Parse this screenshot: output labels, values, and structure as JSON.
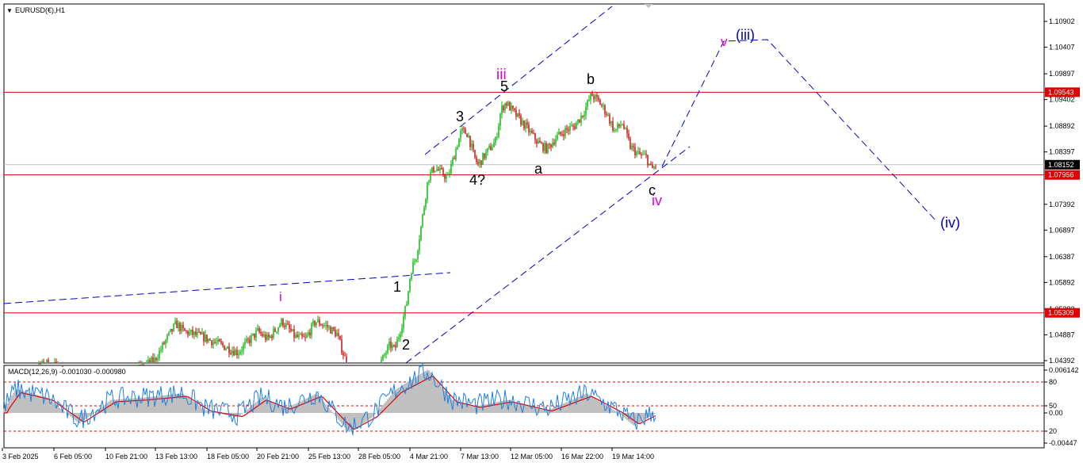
{
  "header": {
    "symbol_label": "EURUSD(€),H1"
  },
  "colors": {
    "bull": "#00b000",
    "bear": "#c00000",
    "level": "#e00000",
    "channel": "#0000c0",
    "magenta": "#e000e0",
    "macd_hist": "#c0c0c0",
    "macd_main": "#1e7fe0",
    "macd_signal": "#e00000"
  },
  "price_axis": {
    "ticks": [
      "1.10902",
      "1.10407",
      "1.09897",
      "1.09402",
      "1.08892",
      "1.08397",
      "1.07392",
      "1.06897",
      "1.06387",
      "1.05892",
      "1.05382",
      "1.04887",
      "1.04392"
    ],
    "range": [
      1.0435,
      1.1135
    ]
  },
  "horizontal_levels": [
    {
      "price": 1.09543,
      "label": "1.09543",
      "tag": "red"
    },
    {
      "price": 1.07956,
      "label": "1.07956",
      "tag": "red"
    },
    {
      "price": 1.05309,
      "label": "1.05309",
      "tag": "red"
    },
    {
      "price": 1.08152,
      "label": "1.08152",
      "tag": "current"
    }
  ],
  "time_axis": {
    "labels": [
      "3 Feb 2025",
      "6 Feb 05:00",
      "10 Feb 21:00",
      "13 Feb 13:00",
      "18 Feb 05:00",
      "20 Feb 21:00",
      "25 Feb 13:00",
      "28 Feb 05:00",
      "4 Mar 21:00",
      "7 Mar 13:00",
      "12 Mar 05:00",
      "16 Mar 22:00",
      "19 Mar 14:00"
    ]
  },
  "wave_labels": [
    {
      "text": "i",
      "color": "magenta"
    },
    {
      "text": "1",
      "color": "black"
    },
    {
      "text": "2",
      "color": "black"
    },
    {
      "text": "3",
      "color": "black"
    },
    {
      "text": "4?",
      "color": "black"
    },
    {
      "text": "5",
      "color": "black"
    },
    {
      "text": "iii",
      "color": "magenta"
    },
    {
      "text": "a",
      "color": "black"
    },
    {
      "text": "b",
      "color": "black"
    },
    {
      "text": "c",
      "color": "black"
    },
    {
      "text": "iv",
      "color": "magenta"
    },
    {
      "text": "v",
      "color": "magenta"
    },
    {
      "text": "(iii)",
      "color": "blue"
    },
    {
      "text": "(iv)",
      "color": "blue"
    }
  ],
  "macd": {
    "label": "MACD(12,26,9) -0.001030 -0.000980",
    "ticks": [
      "0.006142",
      "80",
      "50",
      "0.00",
      "20",
      "-0.00447"
    ],
    "range": [
      -0.00447,
      0.006142
    ]
  },
  "chart_data": {
    "type": "candlestick",
    "symbol": "EURUSD",
    "timeframe": "H1",
    "ylim": [
      1.0435,
      1.1135
    ],
    "key_points": [
      {
        "label": "i",
        "price": 1.053
      },
      {
        "label": "2",
        "price": 1.0445
      },
      {
        "label": "1",
        "price": 1.061
      },
      {
        "label": "3",
        "price": 1.0895
      },
      {
        "label": "4?",
        "price": 1.0805
      },
      {
        "label": "5 / iii",
        "price": 1.0945
      },
      {
        "label": "a",
        "price": 1.0825
      },
      {
        "label": "b",
        "price": 1.0955
      },
      {
        "label": "c / iv",
        "price": 1.079
      }
    ],
    "projection": [
      {
        "label": "v (iii)",
        "price": 1.1055
      },
      {
        "label": "(iv)",
        "price": 1.072
      }
    ],
    "current_price": 1.08152
  }
}
